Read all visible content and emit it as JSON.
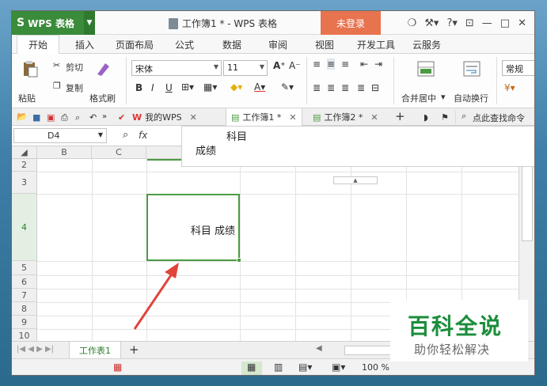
{
  "titlebar": {
    "app_name": "WPS 表格",
    "logo": "S",
    "title": "工作簿1 * - WPS 表格",
    "login": "未登录",
    "controls": [
      "❍",
      "⚒▾",
      "?▾",
      "⊡",
      "—",
      "□",
      "✕"
    ]
  },
  "menu_tabs": [
    "开始",
    "插入",
    "页面布局",
    "公式",
    "数据",
    "审阅",
    "视图",
    "开发工具",
    "云服务"
  ],
  "ribbon": {
    "paste": "粘贴",
    "cut": "剪切",
    "copy": "复制",
    "format_painter": "格式刷",
    "font_name": "宋体",
    "font_size": "11",
    "bold": "B",
    "italic": "I",
    "underline": "U",
    "merge_center": "合并居中",
    "wrap_text": "自动换行",
    "number_format": "常规"
  },
  "doc_tabs": {
    "home": "我的WPS",
    "active": "工作簿1 *",
    "other": "工作簿2 *",
    "add": "+",
    "search": "点此查找命令"
  },
  "formula_bar": {
    "cell_ref": "D4",
    "fx": "fx",
    "content_line1": "科目",
    "content_line2": "成绩"
  },
  "grid": {
    "col_headers": [
      "B",
      "C"
    ],
    "rows": [
      "2",
      "3",
      "4",
      "5",
      "6",
      "7",
      "8",
      "9",
      "10"
    ],
    "selected_cell_text": "科目  成绩"
  },
  "sheet": {
    "tab": "工作表1",
    "add": "+"
  },
  "status": {
    "zoom": "100 %"
  },
  "watermark": {
    "title": "百科全说",
    "subtitle": "助你轻松解决"
  },
  "colors": {
    "accent": "#3a8b3a",
    "selection": "#4c9b43",
    "login": "#e8734f",
    "arrow": "#e0453a"
  }
}
